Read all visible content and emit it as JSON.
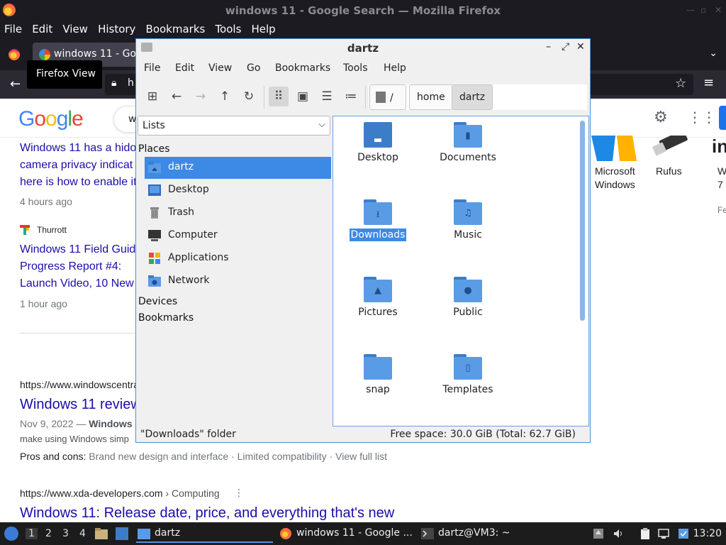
{
  "firefox": {
    "window_title": "windows 11 - Google Search — Mozilla Firefox",
    "menu": [
      "File",
      "Edit",
      "View",
      "History",
      "Bookmarks",
      "Tools",
      "Help"
    ],
    "tab_title": "windows 11 - Goo",
    "tooltip": "Firefox View",
    "url_fragment": "h"
  },
  "google": {
    "logo": "Google",
    "search_fragment": "w",
    "results": {
      "r1_lines": [
        "Windows 11 has a hido",
        "camera privacy indicat",
        "here is how to enable it"
      ],
      "r1_time": "4 hours ago",
      "r2_source": "Thurrott",
      "r2_lines": [
        "Windows 11 Field Guid",
        "Progress Report #4:",
        "Launch Video, 10 New"
      ],
      "r2_time": "1 hour ago",
      "r3_url": "https://www.windowscentra",
      "r3_title": "Windows 11 review",
      "r3_date": "Nov 9, 2022 — ",
      "r3_date_bold": "Windows",
      "r3_snip": "make using Windows simp",
      "r3_pros_label": "Pros and cons: ",
      "r3_pros": "Brand new design and interface · Limited compatibility · View full list",
      "r4_url": "https://www.xda-developers.com",
      "r4_crumb": " › Computing",
      "r4_title": "Windows 11: Release date, price, and everything that's new"
    },
    "side": {
      "a1": "Microsoft",
      "a2": "Windows",
      "b": "Rufus",
      "c1": "W",
      "c2": "7",
      "c3": "Fe",
      "c_big": "in"
    }
  },
  "fm": {
    "title": "dartz",
    "menu": [
      "File",
      "Edit",
      "View",
      "Go",
      "Bookmarks",
      "Tools",
      "Help"
    ],
    "crumbs": [
      "/",
      "home",
      "dartz"
    ],
    "side_select": "Lists",
    "places_header": "Places",
    "places": [
      "dartz",
      "Desktop",
      "Trash",
      "Computer",
      "Applications",
      "Network"
    ],
    "devices_header": "Devices",
    "bookmarks_header": "Bookmarks",
    "files": [
      "Desktop",
      "Documents",
      "Downloads",
      "Music",
      "Pictures",
      "Public",
      "snap",
      "Templates"
    ],
    "status_left": "\"Downloads\" folder",
    "status_right": "Free space: 30.0 GiB (Total: 62.7 GiB)"
  },
  "taskbar": {
    "workspaces": [
      "1",
      "2",
      "3",
      "4"
    ],
    "task_fm": "dartz",
    "task_ff": "windows 11 - Google ...",
    "task_term": "dartz@VM3: ~",
    "clock": "13:20"
  },
  "colors": {
    "accent": "#3c8ae6",
    "folder": "#5a9be6",
    "google_link": "#1a0dab"
  }
}
